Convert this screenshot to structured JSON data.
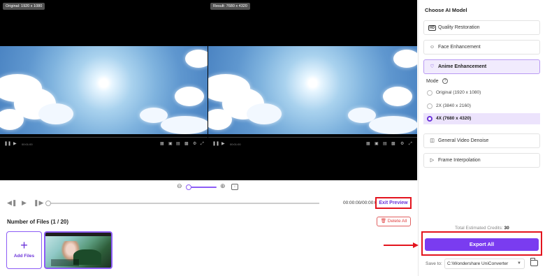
{
  "preview": {
    "original_label": "Original: 1920 x 1080",
    "result_label": "Result: 7680 x 4320",
    "video_time": "00:01:00"
  },
  "playback": {
    "time": "00:00:00/00:00:0",
    "exit_preview_label": "Exit Preview"
  },
  "files": {
    "count_label": "Number of Files (1 / 20)",
    "delete_all_label": "Delete All",
    "add_files_label": "Add Files"
  },
  "panel": {
    "title": "Choose AI Model",
    "models": [
      {
        "label": "Quality Restoration",
        "icon": "hd-icon"
      },
      {
        "label": "Face Enhancement",
        "icon": "face-scan-icon"
      },
      {
        "label": "Anime Enhancement",
        "icon": "anime-cat-icon",
        "active": true
      },
      {
        "label": "General Video Denoise",
        "icon": "denoise-icon"
      },
      {
        "label": "Frame Interpolation",
        "icon": "frame-interpolation-icon"
      }
    ],
    "mode": {
      "title": "Mode",
      "options": [
        {
          "label": "Original (1920 x 1080)"
        },
        {
          "label": "2X (3840 x 2160)"
        },
        {
          "label": "4X (7680 x 4320)",
          "selected": true
        }
      ]
    },
    "total_credits_label": "Total Estimated Credits:",
    "total_credits_value": "30",
    "export_label": "Export All",
    "save_to_label": "Save to:",
    "save_path": "C:\\Wondershare UniConverter"
  },
  "colors": {
    "accent": "#7a3cf0",
    "highlight_red": "#e3141e"
  }
}
